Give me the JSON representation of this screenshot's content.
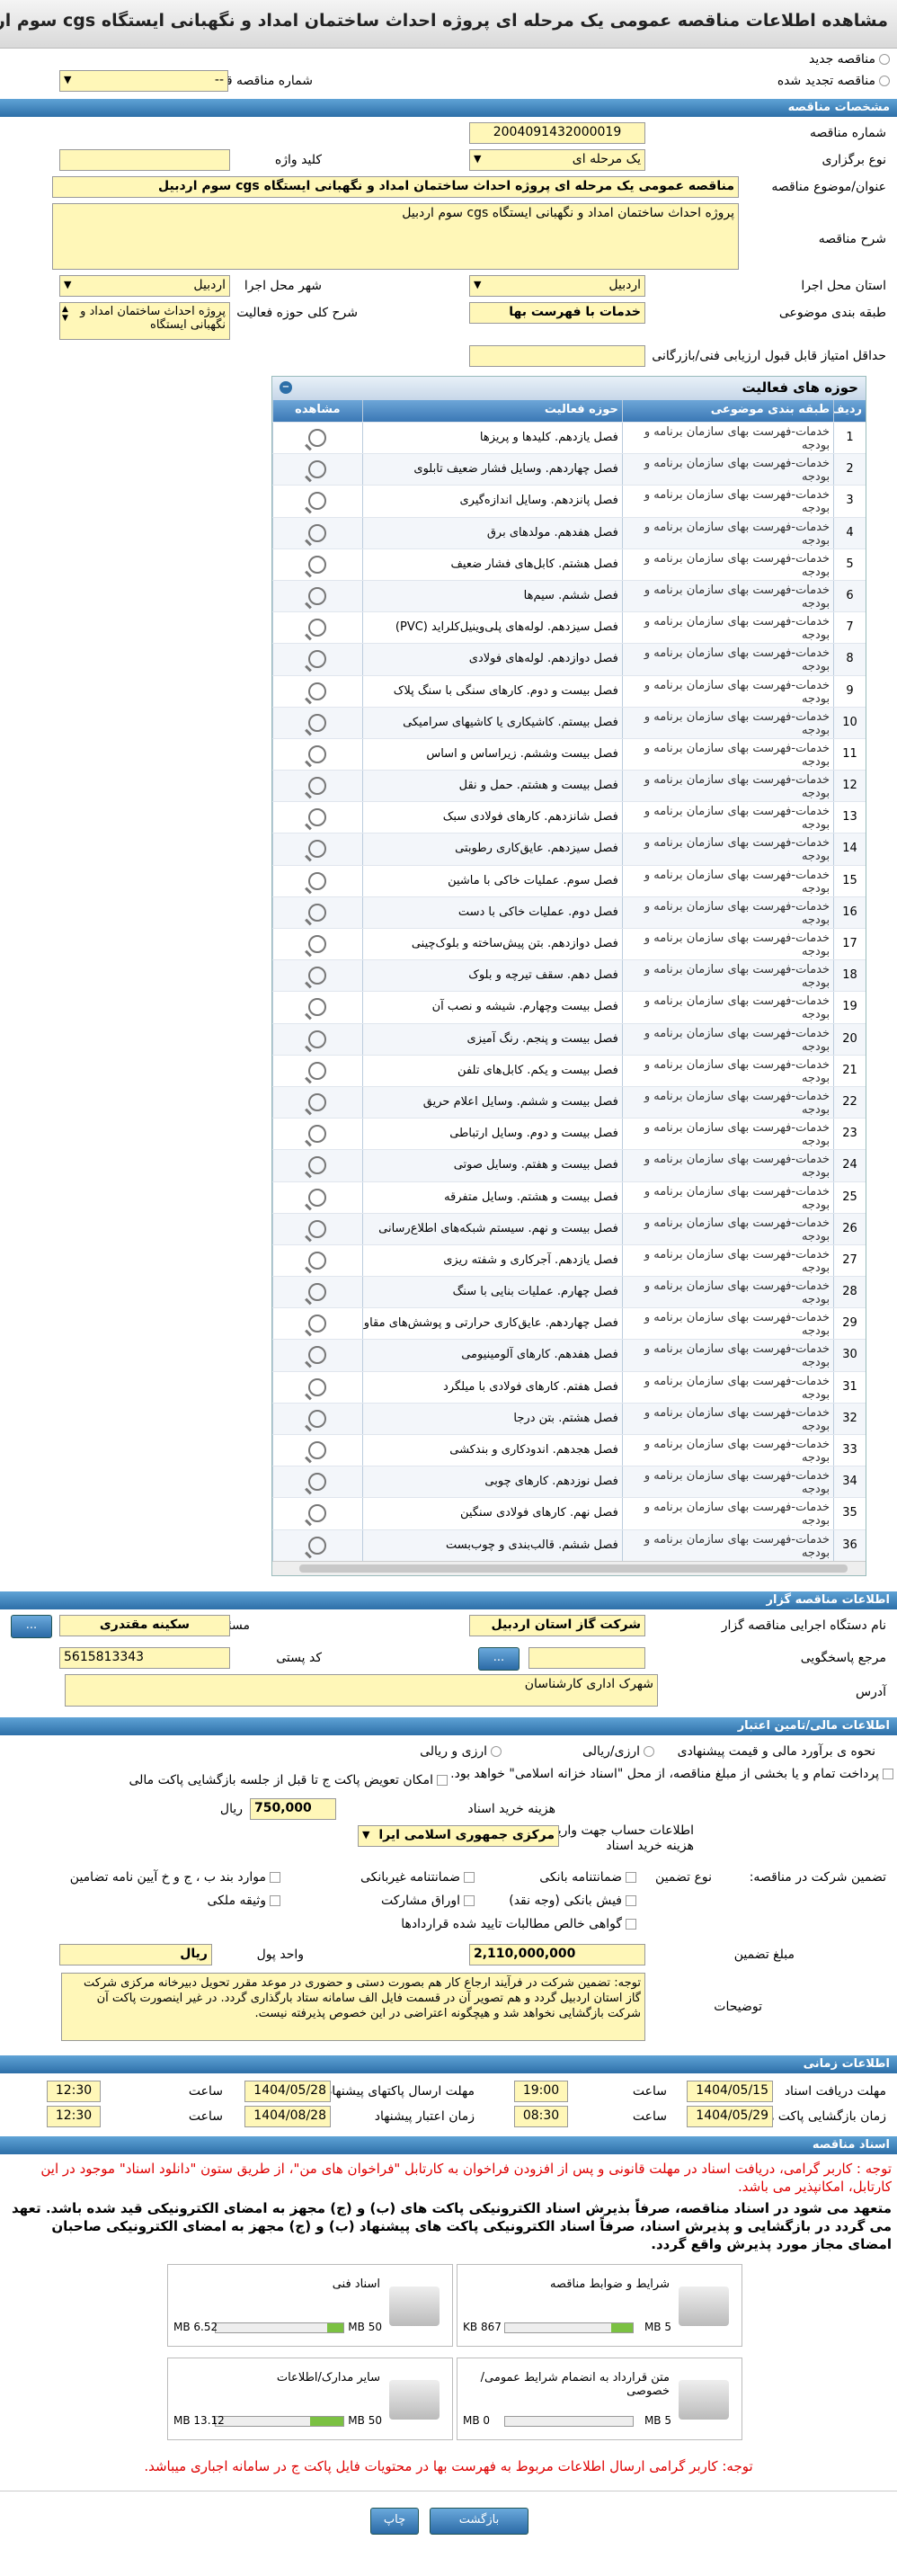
{
  "title": "مشاهده اطلاعات مناقصه عمومی یک مرحله ای پروژه احداث ساختمان امداد و نگهبانی ایستگاه cgs سوم اردبیل",
  "top": {
    "new_label": "مناقصه جدید",
    "renewed_label": "مناقصه تجدید شده",
    "prev_label": "شماره مناقصه قبلی",
    "prev_value": "--"
  },
  "sec_spec": "مشخصات مناقصه",
  "spec": {
    "number_label": "شماره مناقصه",
    "number": "2004091432000019",
    "type_label": "نوع برگزاری",
    "type": "یک مرحله ای",
    "keyword_label": "کلید واژه",
    "subject_label": "عنوان/موضوع مناقصه",
    "subject": "مناقصه عمومی یک مرحله ای پروژه احداث ساختمان امداد و نگهبانی ایستگاه cgs سوم اردبیل",
    "desc_label": "شرح مناقصه",
    "desc": "پروژه احداث ساختمان امداد و نگهبانی ایستگاه cgs سوم اردبیل",
    "province_label": "استان محل اجرا",
    "province": "اردبیل",
    "city_label": "شهر محل اجرا",
    "city": "اردبیل",
    "category_label": "طبقه بندی موضوعی",
    "category": "خدمات با فهرست بها",
    "scope_label": "شرح کلی حوزه فعالیت",
    "scope": "پروژه احداث ساختمان امداد و نگهبانی ایستگاه",
    "minscore_label": "حداقل امتیاز قابل قبول ارزیابی فنی/بازرگانی"
  },
  "grid": {
    "title": "حوزه های فعالیت",
    "cols": [
      "ردیف",
      "طبقه بندی موضوعی",
      "حوزه فعالیت",
      "مشاهده"
    ],
    "cat": "خدمات-فهرست بهای سازمان برنامه و بودجه",
    "rows": [
      [
        "1",
        "فصل یازدهم. کلیدها و پریزها"
      ],
      [
        "2",
        "فصل چهاردهم. وسایل فشار ضعیف تابلوی"
      ],
      [
        "3",
        "فصل پانزدهم. وسایل اندازه‌گیری"
      ],
      [
        "4",
        "فصل هفدهم. مولدهای برق"
      ],
      [
        "5",
        "فصل هشتم. کابل‌های فشار ضعیف"
      ],
      [
        "6",
        "فصل ششم. سیم‌ها"
      ],
      [
        "7",
        "فصل سیزدهم. لوله‌های پلی‌وینیل‌کلراید (PVC)"
      ],
      [
        "8",
        "فصل دوازدهم. لوله‌های فولادی"
      ],
      [
        "9",
        "فصل بیست و دوم. کارهای سنگی با سنگ پلاک"
      ],
      [
        "10",
        "فصل بیستم. کاشیکاری یا کاشیهای سرامیکی"
      ],
      [
        "11",
        "فصل بیست وششم. زیراساس و اساس"
      ],
      [
        "12",
        "فصل بیست و هشتم. حمل و نقل"
      ],
      [
        "13",
        "فصل شانزدهم. کارهای فولادی سبک"
      ],
      [
        "14",
        "فصل سیزدهم. عایق‌کاری رطوبتی"
      ],
      [
        "15",
        "فصل سوم. عملیات خاکی با ماشین"
      ],
      [
        "16",
        "فصل دوم. عملیات خاکی با دست"
      ],
      [
        "17",
        "فصل دوازدهم. بتن پیش‌ساخته و بلوک‌چینی"
      ],
      [
        "18",
        "فصل دهم. سقف تیرچه و بلوک"
      ],
      [
        "19",
        "فصل بیست وچهارم. شیشه و نصب آن"
      ],
      [
        "20",
        "فصل بیست و پنجم. رنگ آمیزی"
      ],
      [
        "21",
        "فصل بیست و یکم. کابل‌های تلفن"
      ],
      [
        "22",
        "فصل بیست و ششم. وسایل اعلام حریق"
      ],
      [
        "23",
        "فصل بیست و دوم. وسایل ارتباطی"
      ],
      [
        "24",
        "فصل بیست و هفتم. وسایل صوتی"
      ],
      [
        "25",
        "فصل بیست و هشتم. وسایل متفرقه"
      ],
      [
        "26",
        "فصل بیست و نهم. سیستم شبکه‌های اطلاع‌رسانی"
      ],
      [
        "27",
        "فصل یازدهم. آجرکاری و شفته ریزی"
      ],
      [
        "28",
        "فصل چهارم. عملیات بنایی با سنگ"
      ],
      [
        "29",
        "فصل چهاردهم. عایق‌کاری حرارتی و پوشش‌های مقاوم در برابر آتش"
      ],
      [
        "30",
        "فصل هفدهم. کارهای آلومینیومی"
      ],
      [
        "31",
        "فصل هفتم. کارهای فولادی با میلگرد"
      ],
      [
        "32",
        "فصل هشتم. بتن درجا"
      ],
      [
        "33",
        "فصل هجدهم. اندودکاری و بندکشی"
      ],
      [
        "34",
        "فصل نوزدهم. کارهای چوبی"
      ],
      [
        "35",
        "فصل نهم. کارهای فولادی سنگین"
      ],
      [
        "36",
        "فصل ششم. قالب‌بندی و چوب‌بست"
      ]
    ]
  },
  "sec_org": "اطلاعات مناقصه گزار",
  "org": {
    "name_label": "نام دستگاه اجرایی مناقصه گزار",
    "name": "شرکت گاز استان اردبیل",
    "reg_label": "مسئول ثبت مناقصه",
    "reg": "سکینه  مقتدری",
    "ref_label": "مرجع پاسخگویی",
    "postal_label": "کد پستی",
    "postal": "5615813343",
    "addr_label": "آدرس",
    "addr": "شهرک اداری کارشناسان",
    "more": "...",
    "pick": "..."
  },
  "sec_fin": "اطلاعات مالی/تامین اعتبار",
  "fin": {
    "est_label": "نحوه ی برآورد مالی و قیمت پیشنهادی",
    "rial": "ارزی/ریالی",
    "arz": "ارزی و ریالی",
    "pay_label": "پرداخت تمام و یا بخشی از مبلغ مناقصه، از محل \"اسناد خزانه اسلامی\" خواهد بود.",
    "swap_label": "امکان تعویض پاکت ج تا قبل از جلسه بازگشایی پاکت مالی",
    "fee_label": "هزینه خرید اسناد",
    "fee": "750,000",
    "fee_unit": "ریال",
    "acct_label": "اطلاعات حساب جهت واریز هزینه خرید اسناد",
    "acct": "مرکزی جمهوری اسلامی ایرا",
    "g_label": "تضمین شرکت در مناقصه:",
    "g_type": "نوع تضمین",
    "g_opts": [
      "ضمانتنامه بانکی",
      "ضمانتنامه غیربانکی",
      "موارد بند ب ، ج و خ آیین نامه تضامین",
      "فیش بانکی (وجه نقد)",
      "اوراق مشارکت",
      "وثیقه ملکی",
      "گواهی خالص مطالبات تایید شده قراردادها"
    ],
    "amt_label": "مبلغ تضمین",
    "amt": "2,110,000,000",
    "unit_label": "واحد پول",
    "unit": "ریال",
    "note_label": "توضیحات",
    "note": "توجه: تضمین شرکت در فرآیند ارجاع کار هم بصورت دستی و حضوری در موعد مقرر تحویل دبیرخانه مرکزی شرکت گاز استان اردبیل گردد و هم تصویر آن در قسمت فایل الف سامانه ستاد بارگذاری گردد. در غیر اینصورت پاکت آن شرکت بازگشایی نخواهد شد و هیچگونه اعتراضی در این خصوص پذیرفته نیست."
  },
  "sec_time": "اطلاعات زمانی",
  "time": {
    "get_label": "مهلت دریافت اسناد",
    "get_date": "1404/05/15",
    "get_time": "19:00",
    "send_label": "مهلت ارسال پاکتهای پیشنهاد",
    "send_date": "1404/05/28",
    "send_time": "12:30",
    "open_label": "زمان بازگشایی پاکت ها",
    "open_date": "1404/05/29",
    "open_time": "08:30",
    "valid_label": "زمان اعتبار پیشنهاد",
    "valid_date": "1404/08/28",
    "valid_time": "12:30",
    "hour": "ساعت"
  },
  "sec_docs": "اسناد مناقصه",
  "docs": {
    "n1": "توجه : کاربر گرامی، دریافت اسناد در مهلت قانونی و پس از افزودن فراخوان به کارتابل \"فراخوان های من\"، از طریق ستون \"دانلود اسناد\" موجود در این کارتابل، امکانپذیر می باشد.",
    "n2": "متعهد می شود در اسناد مناقصه، صرفاً بذیرش اسناد الکترونیکی پاکت های (ب) و (ج) مجهز به امضای الکترونیکی قید شده باشد. تعهد می گردد در بازگشایی و پذیرش اسناد، صرفاً اسناد الکترونیکی پاکت های پیشنهاد (ب) و (ج) مجهز به امضای الکترونیکی صاحبان امضای مجاز مورد پذیرش واقع گردد.",
    "items": [
      {
        "name": "شرایط و ضوابط مناقصه",
        "size": "867 KB",
        "max": "5 MB",
        "fill": 0.17
      },
      {
        "name": "اسناد فنی",
        "size": "6.52 MB",
        "max": "50 MB",
        "fill": 0.13
      },
      {
        "name": "متن قرارداد به انضمام شرایط عمومی/خصوصی",
        "size": "0 MB",
        "max": "5 MB",
        "fill": 0
      },
      {
        "name": "سایر مدارک/اطلاعات",
        "size": "13.12 MB",
        "max": "50 MB",
        "fill": 0.26
      }
    ],
    "n3": "توجه: کاربر گرامی ارسال اطلاعات مربوط به فهرست بها در محتویات فایل پاکت ج در سامانه اجباری میباشد."
  },
  "footer": {
    "back": "بازگشت",
    "print": "چاپ"
  },
  "colors": {
    "accent": "#2d6fa8",
    "field": "#fff7b8",
    "warn": "#dd0000"
  }
}
